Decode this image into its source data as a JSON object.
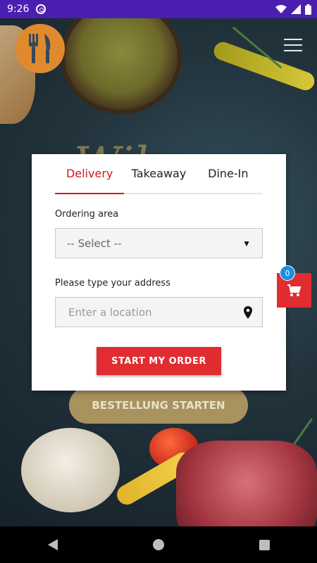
{
  "status_bar": {
    "time": "9:26"
  },
  "modal": {
    "tabs": [
      {
        "label": "Delivery",
        "active": true
      },
      {
        "label": "Takeaway",
        "active": false
      },
      {
        "label": "Dine-In",
        "active": false
      }
    ],
    "ordering_area_label": "Ordering area",
    "ordering_area_selected": "-- Select --",
    "address_label": "Please type your address",
    "address_placeholder": "Enter a location",
    "start_button": "START MY ORDER"
  },
  "background_button": "BESTELLUNG STARTEN",
  "cart": {
    "count": "0"
  },
  "colors": {
    "accent": "#e12d32",
    "active_tab": "#d4161e",
    "status_bar": "#4a1fb0",
    "badge": "#1a8fe0"
  }
}
